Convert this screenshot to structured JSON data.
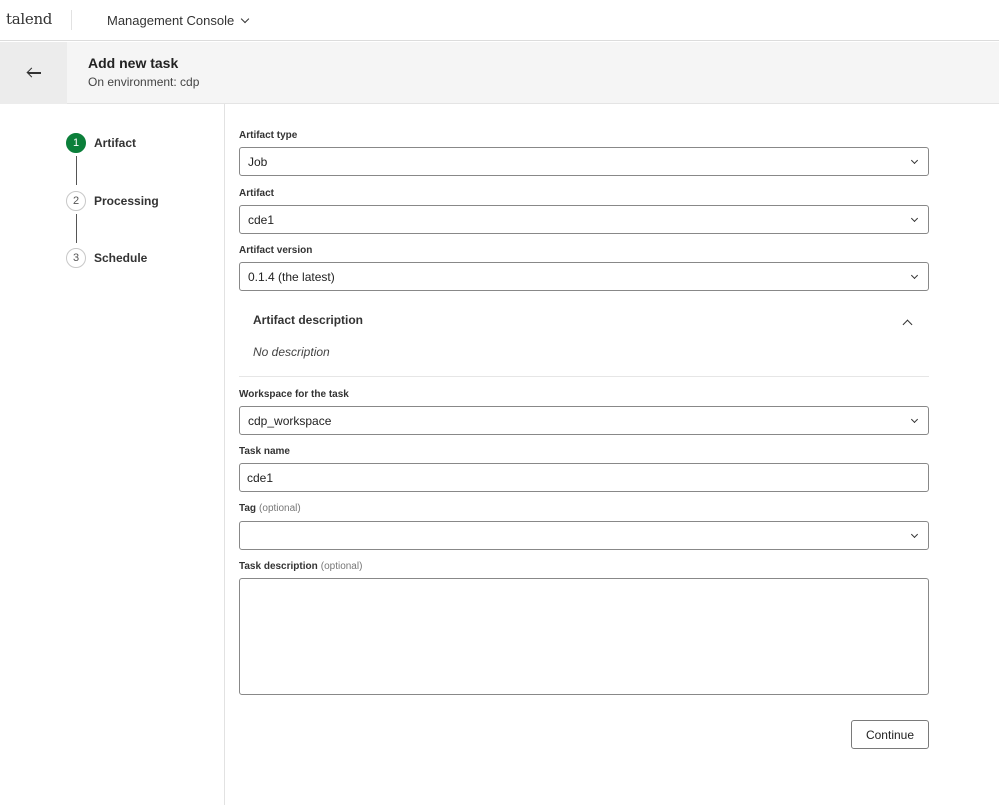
{
  "topbar": {
    "logo": "talend",
    "app_name": "Management Console"
  },
  "header": {
    "title": "Add new task",
    "subtitle": "On environment: cdp"
  },
  "stepper": {
    "steps": [
      {
        "number": "1",
        "label": "Artifact",
        "active": true
      },
      {
        "number": "2",
        "label": "Processing",
        "active": false
      },
      {
        "number": "3",
        "label": "Schedule",
        "active": false
      }
    ]
  },
  "form": {
    "artifact_type": {
      "label": "Artifact type",
      "value": "Job"
    },
    "artifact": {
      "label": "Artifact",
      "value": "cde1"
    },
    "artifact_version": {
      "label": "Artifact version",
      "value": "0.1.4 (the latest)"
    },
    "artifact_description": {
      "title": "Artifact description",
      "text": "No description"
    },
    "workspace": {
      "label": "Workspace for the task",
      "value": "cdp_workspace"
    },
    "task_name": {
      "label": "Task name",
      "value": "cde1"
    },
    "tag": {
      "label": "Tag",
      "optional": "(optional)",
      "value": ""
    },
    "task_description": {
      "label": "Task description",
      "optional": "(optional)",
      "value": ""
    }
  },
  "actions": {
    "continue_label": "Continue"
  },
  "colors": {
    "accent": "#0b7f3a",
    "header_bg": "#f5f5f5"
  }
}
